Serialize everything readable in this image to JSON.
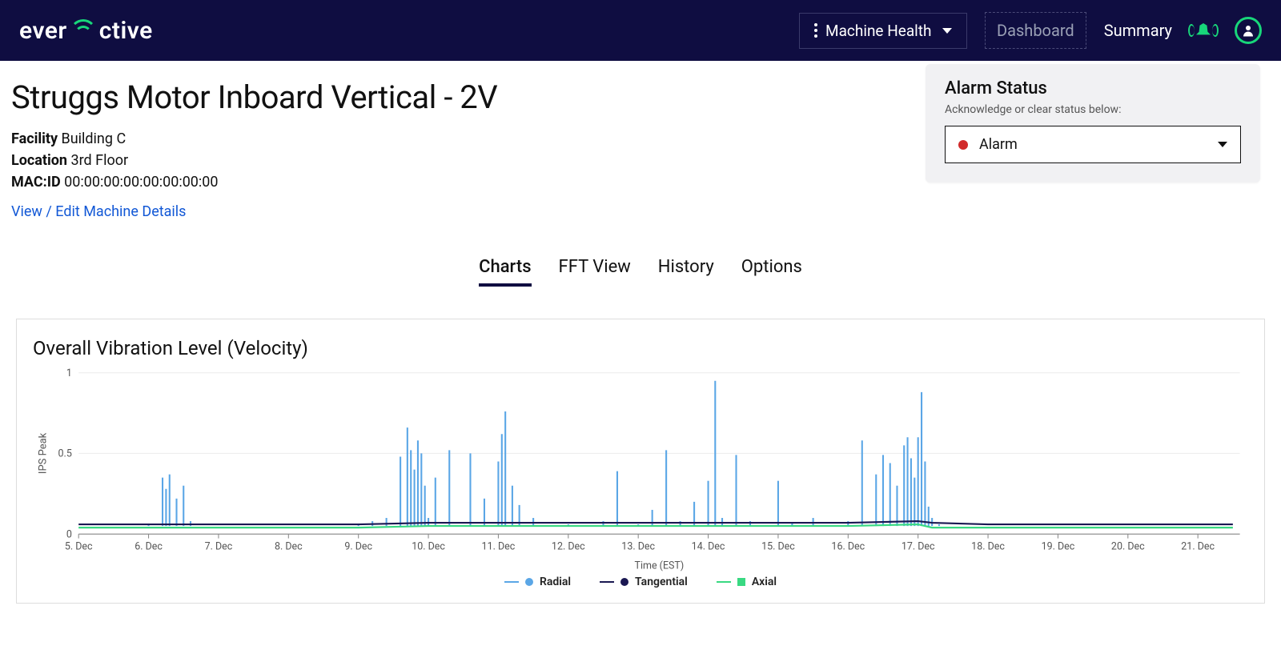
{
  "brand": {
    "name": "everactive",
    "accent_index": 8
  },
  "header": {
    "product_selector": {
      "label": "Machine Health"
    },
    "nav": {
      "dashboard": "Dashboard",
      "summary": "Summary"
    }
  },
  "page": {
    "title": "Struggs Motor Inboard Vertical - 2V",
    "meta": {
      "facility_label": "Facility",
      "facility_value": "Building C",
      "location_label": "Location",
      "location_value": "3rd Floor",
      "macid_label": "MAC:ID",
      "macid_value": "00:00:00:00:00:00:00:00"
    },
    "edit_link": "View / Edit Machine Details"
  },
  "alarm": {
    "title": "Alarm Status",
    "subtitle": "Acknowledge or clear status below:",
    "selected": "Alarm",
    "status_color": "#d12b2b"
  },
  "tabs": {
    "items": [
      "Charts",
      "FFT View",
      "History",
      "Options"
    ],
    "active_index": 0
  },
  "chart": {
    "title": "Overall Vibration Level (Velocity)",
    "ylabel": "IPS Peak",
    "xlabel": "Time (EST)",
    "legend": [
      {
        "name": "Radial",
        "color": "#5aa6e6",
        "marker": "dot"
      },
      {
        "name": "Tangential",
        "color": "#1a1852",
        "marker": "line"
      },
      {
        "name": "Axial",
        "color": "#39d982",
        "marker": "square"
      }
    ]
  },
  "chart_data": {
    "type": "line",
    "title": "Overall Vibration Level (Velocity)",
    "xlabel": "Time (EST)",
    "ylabel": "IPS Peak",
    "ylim": [
      0,
      1
    ],
    "y_ticks": [
      0,
      0.5,
      1
    ],
    "x_ticks": [
      "5. Dec",
      "6. Dec",
      "7. Dec",
      "8. Dec",
      "9. Dec",
      "10. Dec",
      "11. Dec",
      "12. Dec",
      "13. Dec",
      "14. Dec",
      "15. Dec",
      "16. Dec",
      "17. Dec",
      "18. Dec",
      "19. Dec",
      "20. Dec",
      "21. Dec"
    ],
    "series": [
      {
        "name": "Radial",
        "color": "#5aa6e6",
        "x": [
          5.0,
          5.5,
          6.0,
          6.2,
          6.25,
          6.3,
          6.4,
          6.5,
          6.6,
          7.0,
          7.5,
          8.0,
          8.5,
          9.0,
          9.2,
          9.4,
          9.6,
          9.7,
          9.75,
          9.8,
          9.85,
          9.9,
          9.95,
          10.0,
          10.1,
          10.3,
          10.6,
          10.8,
          11.0,
          11.05,
          11.1,
          11.2,
          11.3,
          11.5,
          12.0,
          12.5,
          12.7,
          13.0,
          13.2,
          13.4,
          13.6,
          13.8,
          14.0,
          14.1,
          14.2,
          14.4,
          14.6,
          15.0,
          15.2,
          15.5,
          16.0,
          16.2,
          16.4,
          16.5,
          16.6,
          16.7,
          16.8,
          16.85,
          16.9,
          16.95,
          17.0,
          17.05,
          17.1,
          17.15,
          17.2,
          17.3,
          18.0,
          19.0,
          20.0,
          21.0,
          21.5
        ],
        "values": [
          0.05,
          0.05,
          0.06,
          0.35,
          0.28,
          0.37,
          0.22,
          0.3,
          0.08,
          0.05,
          0.05,
          0.05,
          0.05,
          0.06,
          0.08,
          0.1,
          0.48,
          0.66,
          0.52,
          0.4,
          0.58,
          0.5,
          0.3,
          0.1,
          0.35,
          0.52,
          0.5,
          0.22,
          0.45,
          0.62,
          0.76,
          0.3,
          0.18,
          0.1,
          0.06,
          0.08,
          0.39,
          0.06,
          0.15,
          0.52,
          0.08,
          0.2,
          0.33,
          0.95,
          0.1,
          0.49,
          0.08,
          0.33,
          0.07,
          0.1,
          0.08,
          0.58,
          0.37,
          0.49,
          0.44,
          0.3,
          0.55,
          0.6,
          0.47,
          0.35,
          0.6,
          0.88,
          0.45,
          0.17,
          0.1,
          0.06,
          0.05,
          0.05,
          0.05,
          0.05,
          0.05
        ]
      },
      {
        "name": "Tangential",
        "color": "#1a1852",
        "x": [
          5.0,
          6.0,
          7.0,
          8.0,
          9.0,
          10.0,
          11.0,
          12.0,
          13.0,
          14.0,
          15.0,
          16.0,
          17.0,
          17.2,
          18.0,
          19.0,
          20.0,
          21.0,
          21.5
        ],
        "values": [
          0.06,
          0.06,
          0.06,
          0.06,
          0.06,
          0.07,
          0.07,
          0.07,
          0.07,
          0.07,
          0.07,
          0.07,
          0.08,
          0.07,
          0.06,
          0.06,
          0.06,
          0.06,
          0.06
        ]
      },
      {
        "name": "Axial",
        "color": "#39d982",
        "x": [
          5.0,
          6.0,
          7.0,
          8.0,
          9.0,
          10.0,
          11.0,
          12.0,
          13.0,
          14.0,
          15.0,
          16.0,
          17.0,
          17.2,
          18.0,
          19.0,
          20.0,
          21.0,
          21.5
        ],
        "values": [
          0.04,
          0.04,
          0.04,
          0.04,
          0.04,
          0.05,
          0.05,
          0.05,
          0.05,
          0.05,
          0.05,
          0.05,
          0.06,
          0.04,
          0.04,
          0.04,
          0.04,
          0.04,
          0.04
        ]
      }
    ]
  }
}
